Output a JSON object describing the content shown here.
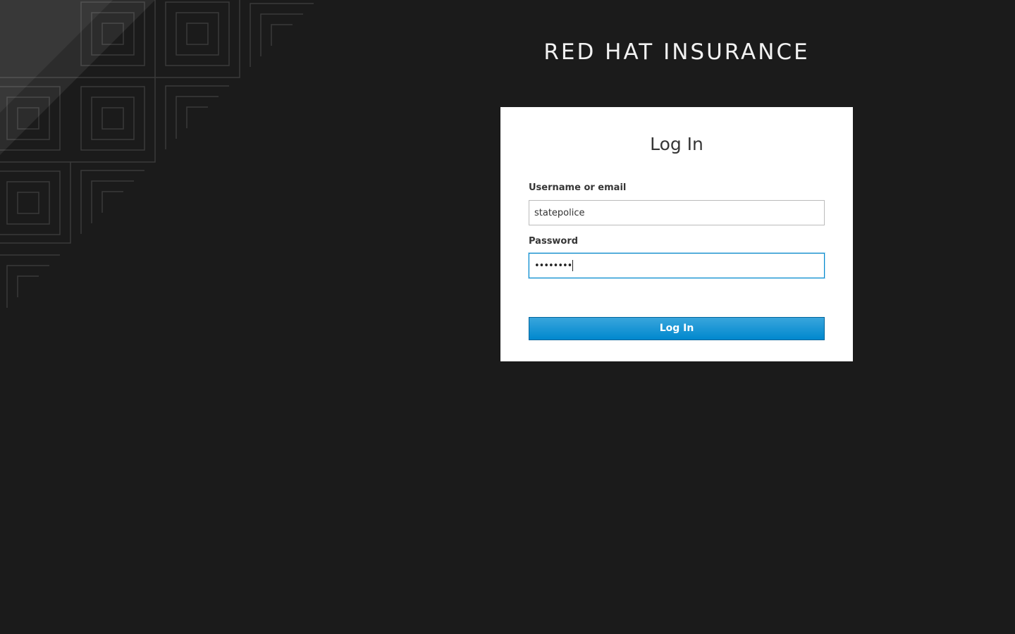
{
  "brand": {
    "title": "RED HAT INSURANCE"
  },
  "login_card": {
    "title": "Log In",
    "username": {
      "label": "Username or email",
      "value": "statepolice"
    },
    "password": {
      "label": "Password",
      "masked_value": "••••••••"
    },
    "submit_label": "Log In"
  },
  "colors": {
    "background": "#1b1b1b",
    "card": "#ffffff",
    "accent": "#0088ce",
    "button_top": "#39a5dc",
    "button_bottom": "#0088ce"
  }
}
